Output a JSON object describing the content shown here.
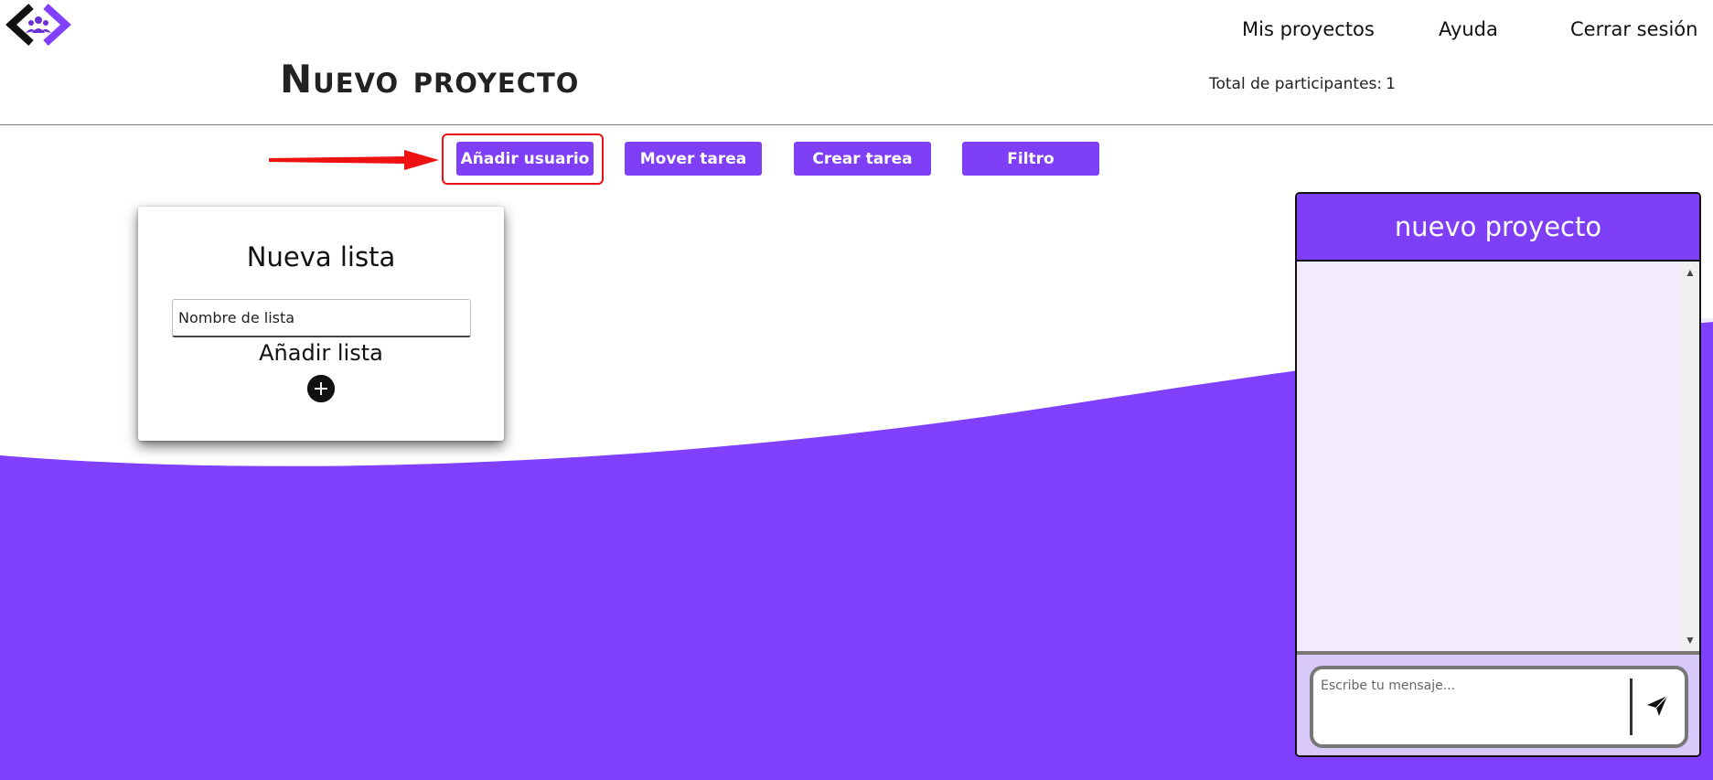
{
  "nav": {
    "links": [
      "Mis proyectos",
      "Ayuda",
      "Cerrar sesión"
    ]
  },
  "project": {
    "title": "Nuevo proyecto",
    "participants_label": "Total de participantes:",
    "participants_count": "1"
  },
  "toolbar": {
    "buttons": [
      "Añadir usuario",
      "Mover tarea",
      "Crear tarea",
      "Filtro"
    ]
  },
  "new_list": {
    "title": "Nueva lista",
    "input_placeholder": "Nombre de lista",
    "add_label": "Añadir lista"
  },
  "chat": {
    "title": "nuevo proyecto",
    "input_placeholder": "Escribe tu mensaje..."
  },
  "colors": {
    "accent": "#7e3ff7",
    "wave_light": "#f1ebfd",
    "chat_footer": "#d9c9fb",
    "highlight": "#ee1111"
  },
  "icons": [
    "app-logo-icon",
    "annotation-arrow-icon",
    "plus-circle-icon",
    "send-icon"
  ]
}
